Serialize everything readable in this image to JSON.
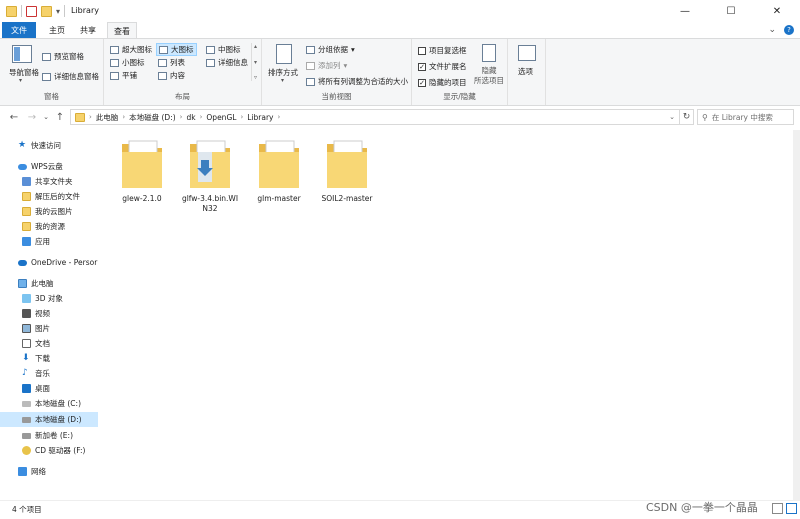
{
  "window": {
    "title": "Library",
    "minimize": "—",
    "maximize": "☐",
    "close": "✕"
  },
  "tabs": [
    {
      "label": "文件"
    },
    {
      "label": "主页"
    },
    {
      "label": "共享"
    },
    {
      "label": "查看"
    }
  ],
  "ribbon": {
    "panes": {
      "nav_pane": "导航窗格",
      "preview_pane": "预览窗格",
      "details_pane": "详细信息窗格",
      "label": "窗格"
    },
    "layout": {
      "items": [
        "超大图标",
        "大图标",
        "中图标",
        "小图标",
        "列表",
        "详细信息",
        "平铺",
        "内容"
      ],
      "label": "布局"
    },
    "current_view": {
      "sort_by": "排序方式",
      "group_by": "分组依据",
      "add_columns": "添加列",
      "size_columns": "将所有列调整为合适的大小",
      "label": "当前视图"
    },
    "show_hide": {
      "item_checkboxes": "项目复选框",
      "file_extensions": "文件扩展名",
      "hidden_items": "隐藏的项目",
      "hide_selected_1": "隐藏",
      "hide_selected_2": "所选项目",
      "label": "显示/隐藏"
    },
    "options": {
      "label": "选项"
    }
  },
  "address": {
    "crumbs": [
      "此电脑",
      "本地磁盘 (D:)",
      "dk",
      "OpenGL",
      "Library"
    ],
    "search_placeholder": "在 Library 中搜索"
  },
  "nav": {
    "items": [
      {
        "label": "快速访问"
      },
      {
        "label": "WPS云盘"
      },
      {
        "label": "共享文件夹"
      },
      {
        "label": "解压后的文件"
      },
      {
        "label": "我的云图片"
      },
      {
        "label": "我的资源"
      },
      {
        "label": "应用"
      },
      {
        "label": "OneDrive - Persor"
      },
      {
        "label": "此电脑"
      },
      {
        "label": "3D 对象"
      },
      {
        "label": "视频"
      },
      {
        "label": "图片"
      },
      {
        "label": "文档"
      },
      {
        "label": "下载"
      },
      {
        "label": "音乐"
      },
      {
        "label": "桌面"
      },
      {
        "label": "本地磁盘 (C:)"
      },
      {
        "label": "本地磁盘 (D:)"
      },
      {
        "label": "新加卷 (E:)"
      },
      {
        "label": "CD 驱动器 (F:)"
      },
      {
        "label": "网络"
      }
    ]
  },
  "files": [
    {
      "name": "glew-2.1.0"
    },
    {
      "name": "glfw-3.4.bin.WIN32"
    },
    {
      "name": "glm-master"
    },
    {
      "name": "SOIL2-master"
    }
  ],
  "status": {
    "count": "4 个项目"
  },
  "watermark": "CSDN @一拳一个晶晶",
  "colors": {
    "accent": "#1a73c8",
    "folder": "#f6d26b",
    "selection": "#cce8ff"
  }
}
